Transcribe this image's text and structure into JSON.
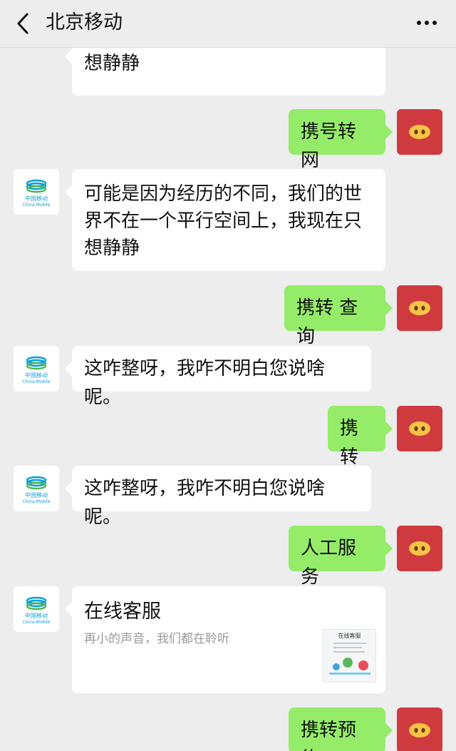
{
  "header": {
    "title": "北京移动"
  },
  "messages": [
    {
      "from": "bot",
      "text": "想静静"
    },
    {
      "from": "me",
      "text": "携号转网"
    },
    {
      "from": "bot",
      "text": "可能是因为经历的不同，我们的世界不在一个平行空间上，我现在只想静静"
    },
    {
      "from": "me",
      "text": "携转 查询"
    },
    {
      "from": "bot",
      "text": "这咋整呀，我咋不明白您说啥呢。"
    },
    {
      "from": "me",
      "text": "携转"
    },
    {
      "from": "bot",
      "text": "这咋整呀，我咋不明白您说啥呢。"
    },
    {
      "from": "me",
      "text": "人工服务"
    },
    {
      "from": "bot",
      "card": {
        "title": "在线客服",
        "desc": "再小的声音，我们都在聆听",
        "thumb_title": "在线客服"
      }
    },
    {
      "from": "me",
      "text": "携转预约"
    }
  ],
  "bot_avatar": {
    "logo_cn": "中国移动",
    "logo_en": "China Mobile",
    "brand_color": "#0a9ed9"
  },
  "colors": {
    "out_bubble": "#95ec69",
    "in_bubble": "#ffffff",
    "user_avatar": "#cf3a3f",
    "background": "#ededed"
  }
}
